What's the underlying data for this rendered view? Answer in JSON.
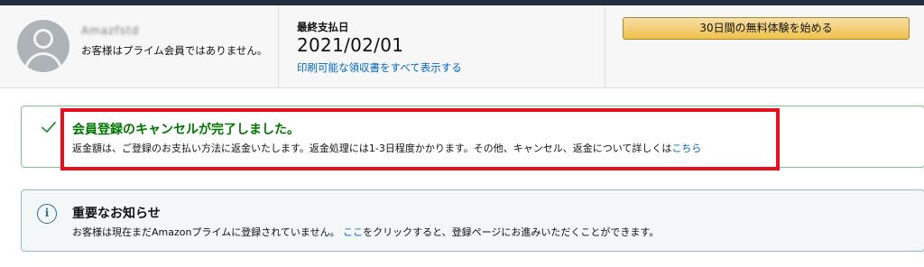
{
  "membership": {
    "member_name": "Amazfstd",
    "status_text": "お客様はプライム会員ではありません。"
  },
  "payment": {
    "label": "最終支払日",
    "date": "2021/02/01",
    "receipt_link": "印刷可能な領収書をすべて表示する"
  },
  "trial": {
    "button_label": "30日間の無料体験を始める"
  },
  "success_alert": {
    "title": "会員登録のキャンセルが完了しました。",
    "body": "返金額は、ご登録のお支払い方法に返金いたします。返金処理には1-3日程度かかります。その他、キャンセル、返金について詳しくは",
    "link": "こちら"
  },
  "info_alert": {
    "icon_glyph": "i",
    "title": "重要なお知らせ",
    "body_before": "お客様は現在まだAmazonプライムに登録されていません。",
    "link": "ここ",
    "body_after": "をクリックすると、登録ページにお進みいただくことができます。"
  },
  "colors": {
    "success_text": "#007600",
    "link": "#0066c0",
    "highlight": "#e8101e",
    "button": "#f0c14b"
  },
  "icons": {
    "avatar": "avatar-icon",
    "success": "check-icon",
    "info": "info-icon"
  }
}
